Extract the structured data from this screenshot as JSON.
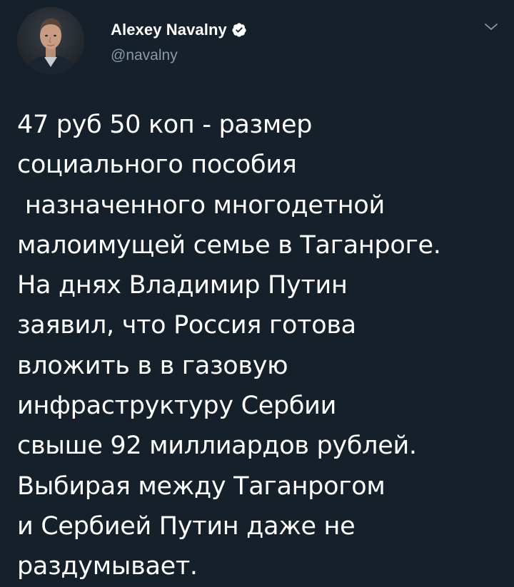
{
  "author": {
    "display_name": "Alexey Navalny",
    "handle": "@navalny",
    "verified": true,
    "avatar_icon": "avatar-photo",
    "verified_icon": "verified-badge-icon"
  },
  "menu": {
    "icon": "chevron-down-icon"
  },
  "tweet": {
    "lines": [
      "47 руб 50 коп - размер",
      "социального пособия",
      " назначенного многодетной",
      "малоимущей семье в Таганроге.",
      "На днях Владимир Путин",
      "заявил, что Россия готова",
      "вложить в в газовую",
      "инфраструктуру Сербии",
      "свыше 92 миллиардов рублей.",
      "Выбирая между Таганрогом",
      "и Сербией Путин даже не",
      "раздумывает."
    ]
  },
  "colors": {
    "background": "#15202b",
    "text": "#ffffff",
    "secondary_text": "#8899a6",
    "verified": "#ffffff"
  }
}
